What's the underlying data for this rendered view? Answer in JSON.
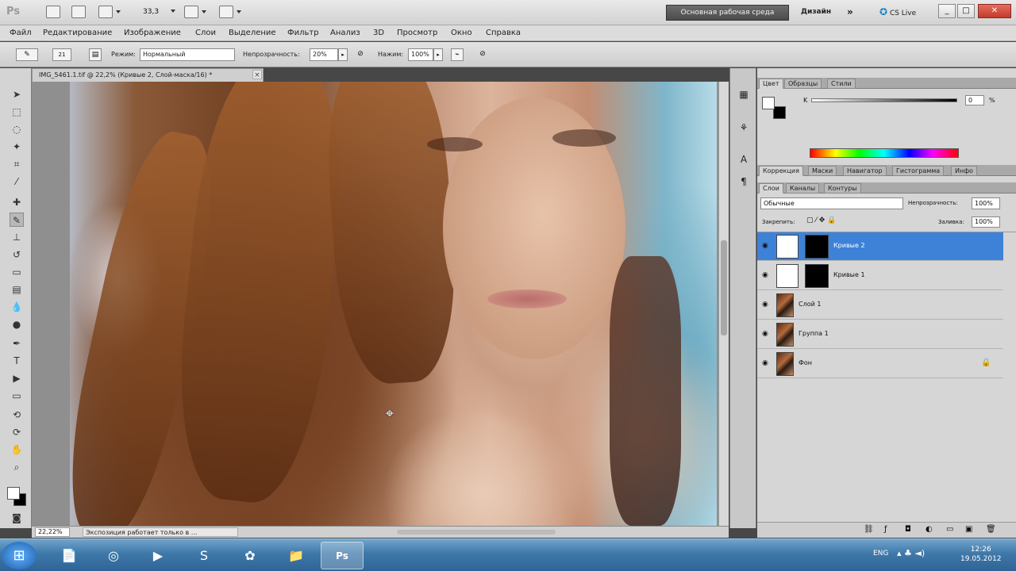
{
  "titlebar": {
    "logo": "Ps",
    "workspace_button": "Основная рабочая среда",
    "design_link": "Дизайн",
    "more": "»",
    "cs_live": "CS Live",
    "win_min": "_",
    "win_max": "□",
    "win_close": "✕",
    "zoom_value": "33,3"
  },
  "menubar": {
    "items": [
      "Файл",
      "Редактирование",
      "Изображение",
      "Слои",
      "Выделение",
      "Фильтр",
      "Анализ",
      "3D",
      "Просмотр",
      "Окно",
      "Справка"
    ]
  },
  "options": {
    "mode_label": "Режим:",
    "mode_value": "Нормальный",
    "opacity_label": "Непрозрачность:",
    "opacity_value": "20%",
    "flow_label": "Нажим:",
    "flow_value": "100%",
    "brush_size": "21"
  },
  "document": {
    "tab_title": "IMG_5461.1.tif @ 22,2% (Кривые 2, Слой-маска/16) *",
    "zoom": "22,22%",
    "status_msg": "Экспозиция работает только в ..."
  },
  "color_panel": {
    "tabs": [
      "Цвет",
      "Образцы",
      "Стили"
    ],
    "channel_label": "K",
    "channel_value": "0",
    "unit": "%"
  },
  "adjust_panel": {
    "tabs": [
      "Коррекция",
      "Маски",
      "Навигатор",
      "Гистограмма",
      "Инфо"
    ]
  },
  "layers_panel": {
    "tabs": [
      "Слои",
      "Каналы",
      "Контуры"
    ],
    "blend_mode": "Обычные",
    "opacity_label": "Непрозрачность:",
    "opacity_value": "100%",
    "lock_label": "Закрепить:",
    "fill_label": "Заливка:",
    "fill_value": "100%",
    "layers": [
      {
        "name": "Кривые 2",
        "type": "adjustment",
        "selected": true
      },
      {
        "name": "Кривые 1",
        "type": "adjustment",
        "selected": false
      },
      {
        "name": "Слой 1",
        "type": "pixel",
        "selected": false
      },
      {
        "name": "Группа 1",
        "type": "pixel",
        "selected": false
      },
      {
        "name": "Фон",
        "type": "background",
        "selected": false
      }
    ],
    "bottom_icons": [
      "link-icon",
      "fx-icon",
      "mask-icon",
      "adjustment-icon",
      "folder-icon",
      "new-layer-icon",
      "trash-icon"
    ]
  },
  "taskbar": {
    "time": "12:26",
    "date": "19.05.2012",
    "lang": "ENG",
    "ps_label": "Ps"
  },
  "colors": {
    "selection_blue": "#3e82d8",
    "chrome_gray": "#d6d6d6"
  }
}
